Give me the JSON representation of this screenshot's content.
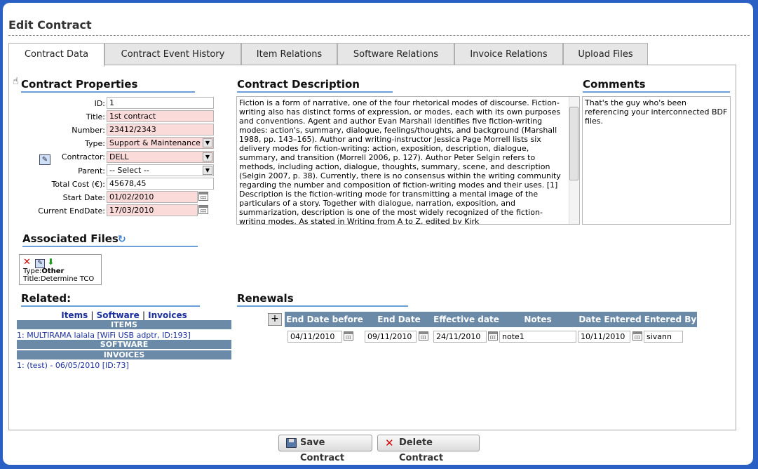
{
  "page_title": "Edit Contract",
  "tabs": [
    {
      "label": "Contract Data"
    },
    {
      "label": "Contract Event History"
    },
    {
      "label": "Item Relations"
    },
    {
      "label": "Software Relations"
    },
    {
      "label": "Invoice Relations"
    },
    {
      "label": "Upload Files"
    }
  ],
  "properties": {
    "title": "Contract Properties",
    "id_label": "ID:",
    "id_value": "1",
    "title_label": "Title:",
    "title_value": "1st contract",
    "number_label": "Number:",
    "number_value": "23412/2343",
    "type_label": "Type:",
    "type_value": "Support & Maintenance",
    "contractor_label": "Contractor:",
    "contractor_value": "DELL",
    "parent_label": "Parent:",
    "parent_value": "-- Select --",
    "total_cost_label": "Total Cost (€):",
    "total_cost_value": "45678,45",
    "start_date_label": "Start Date:",
    "start_date_value": "01/02/2010",
    "end_date_label": "Current EndDate:",
    "end_date_value": "17/03/2010"
  },
  "description": {
    "title": "Contract Description",
    "text": "Fiction is a form of narrative, one of the four rhetorical modes of discourse. Fiction-writing also has distinct forms of expression, or modes, each with its own purposes and conventions. Agent and author Evan Marshall identifies five fiction-writing modes: action's, summary, dialogue, feelings/thoughts, and background (Marshall 1988, pp. 143–165). Author and writing-instructor Jessica Page Morrell lists six delivery modes for fiction-writing: action, exposition, description, dialogue, summary, and transition (Morrell 2006, p. 127). Author Peter Selgin refers to methods, including action, dialogue, thoughts, summary, scene, and description (Selgin 2007, p. 38). Currently, there is no consensus within the writing community regarding the number and composition of fiction-writing modes and their uses. [1] Description is the fiction-writing mode for transmitting a mental image of the particulars of a story. Together with dialogue, narration, exposition, and summarization, description is one of the most widely recognized of the fiction-writing modes. As stated in Writing from A to Z, edited by Kirk"
  },
  "comments": {
    "title": "Comments",
    "text": "That's the guy who's been referencing your interconnected BDF files."
  },
  "files": {
    "title": "Associated Files",
    "type_label": "Type:",
    "type_value": "Other",
    "title_label": "Title:",
    "title_value": "Determine TCO"
  },
  "related": {
    "title": "Related:",
    "link_items": "Items",
    "link_software": "Software",
    "link_invoices": "Invoices",
    "sep": "|",
    "items_header": "ITEMS",
    "item_1": "1: MULTIRAMA lalala [WiFi USB adptr, ID:193]",
    "software_header": "SOFTWARE",
    "invoices_header": "INVOICES",
    "invoice_1": "1: (test) - 06/05/2010 [ID:73]"
  },
  "renewals": {
    "title": "Renewals",
    "add_label": "+",
    "columns": [
      "End Date before",
      "End Date after",
      "Effective date",
      "Notes",
      "Date Entered",
      "Entered By"
    ],
    "row": {
      "end_before": "04/11/2010",
      "end_after": "09/11/2010",
      "effective": "24/11/2010",
      "notes": "note1",
      "date_entered": "10/11/2010",
      "entered_by": "sivann"
    }
  },
  "actions": {
    "save_label": "Save Contract",
    "delete_label": "Delete Contract"
  },
  "colors": {
    "background": "#2a5fc4",
    "required_field": "#fbdada",
    "bar_header": "#6b8aa8",
    "link": "#1a2fa0",
    "title_underline": "#6a9fd8"
  }
}
